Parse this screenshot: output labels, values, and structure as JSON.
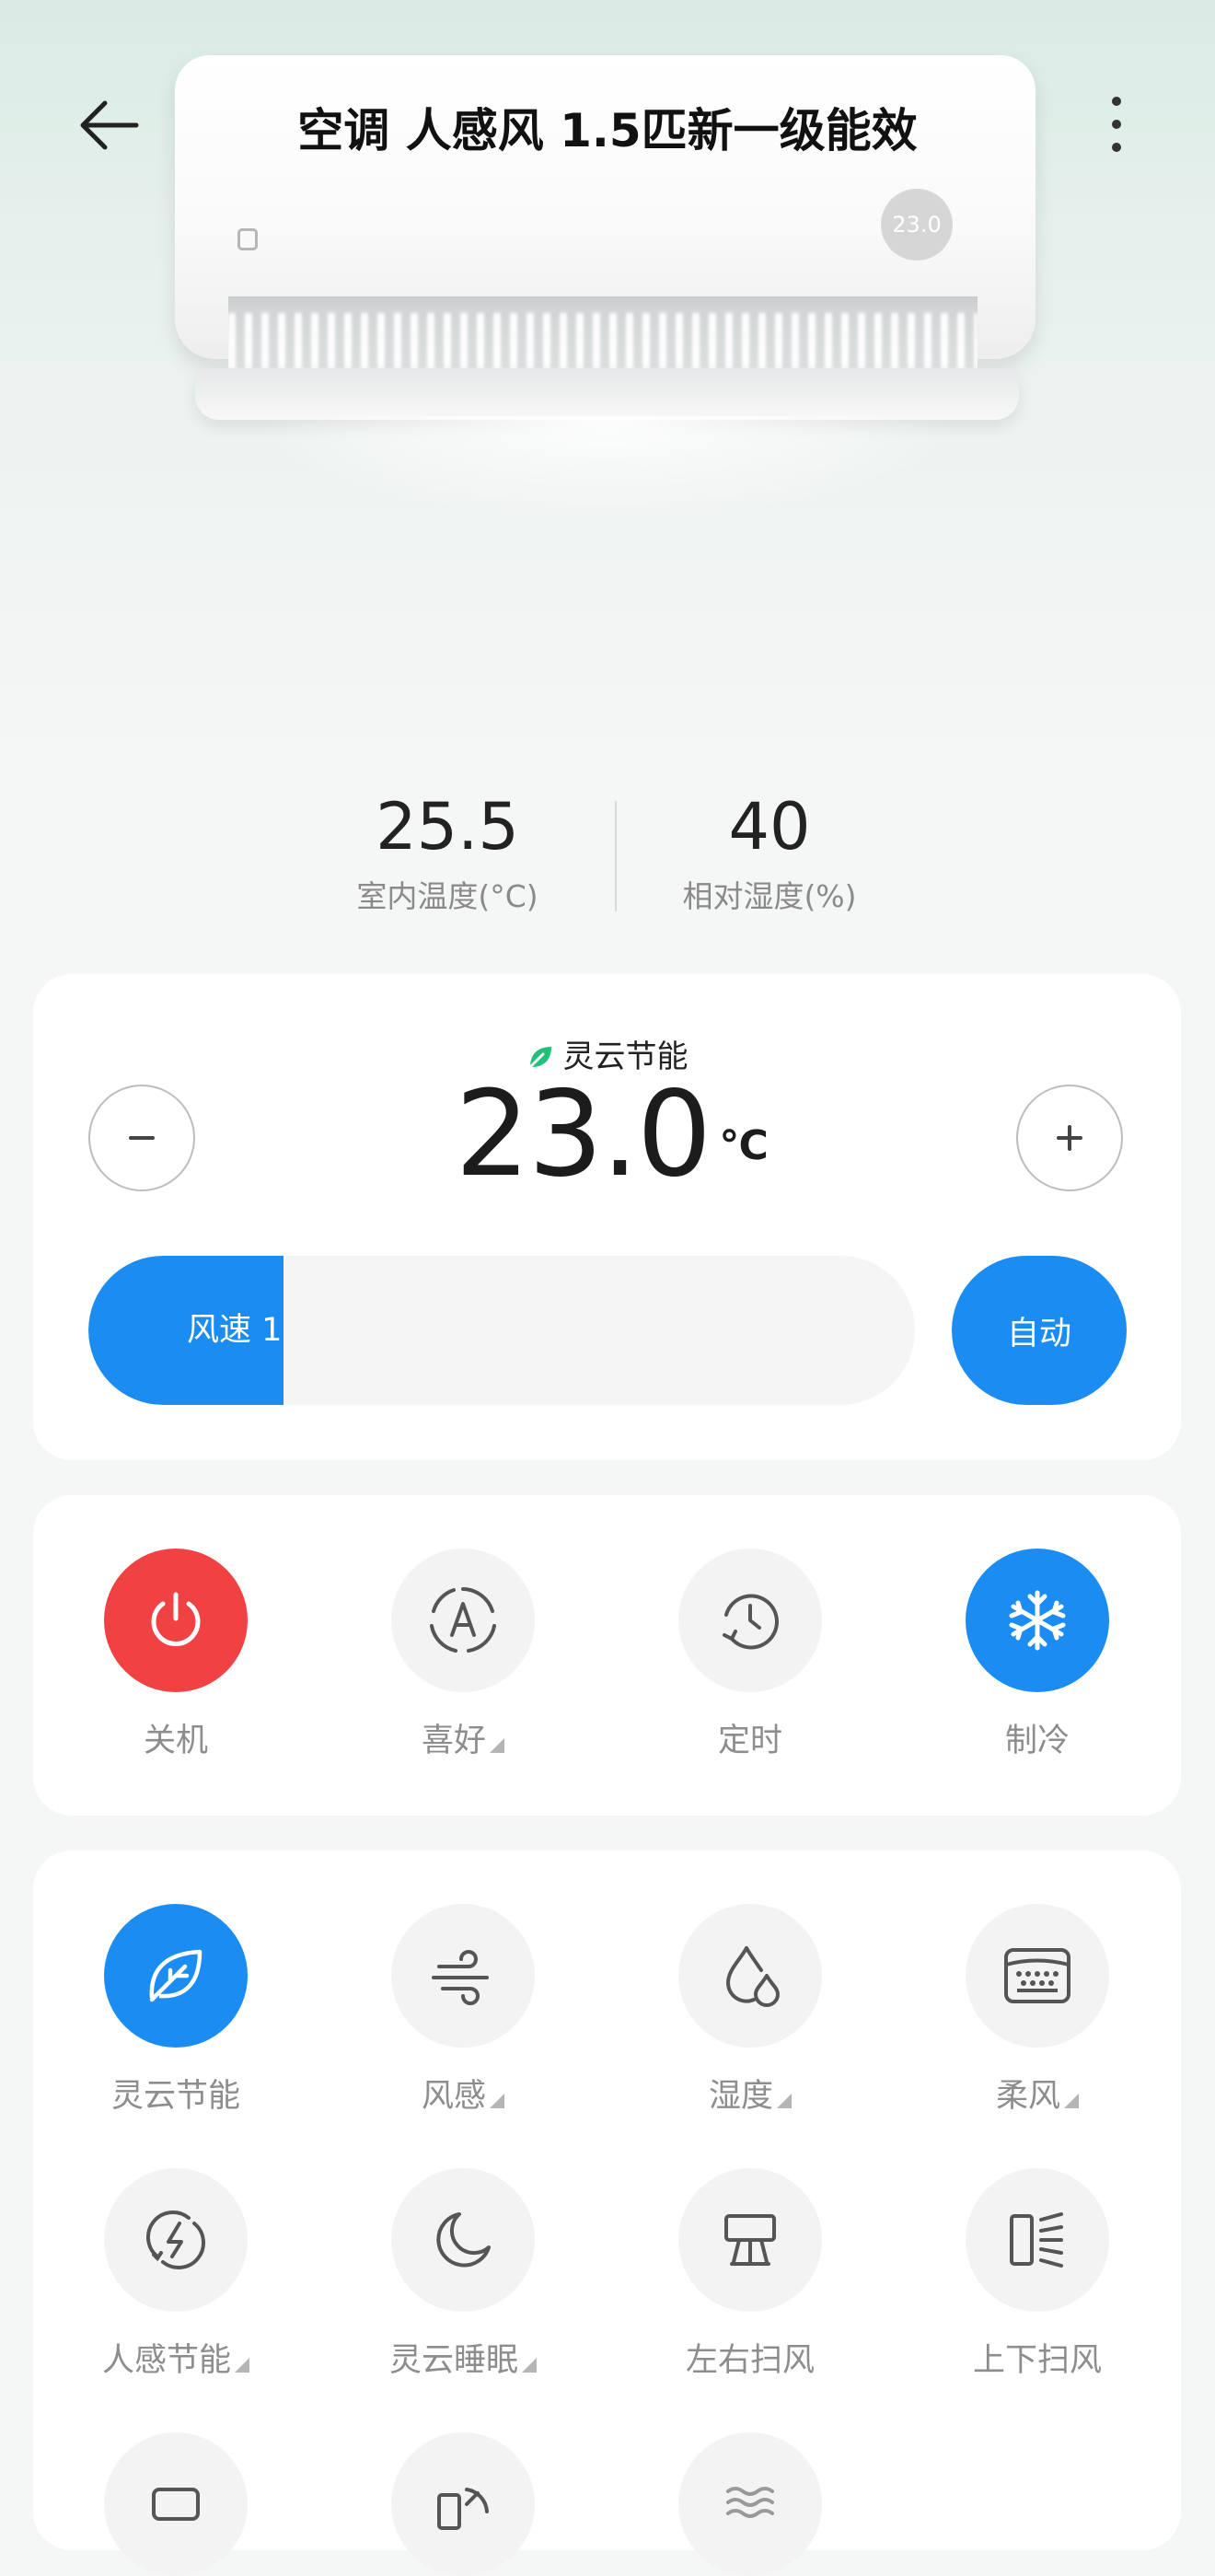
{
  "header": {
    "title": "空调 人感风 1.5匹新一级能效",
    "back_icon": "arrow-left-icon",
    "more_icon": "more-vertical-icon"
  },
  "device_image": {
    "display_temp": "23.0"
  },
  "readings": {
    "indoor_temp": {
      "value": "25.5",
      "label": "室内温度(°C)"
    },
    "humidity": {
      "value": "40",
      "label": "相对湿度(%)"
    }
  },
  "temp_card": {
    "eco_label": "灵云节能",
    "target_temp": "23.0",
    "unit": "℃",
    "fan_speed_label": "风速 1",
    "fan_speed_level": 0.2,
    "auto_label": "自动"
  },
  "controls": [
    {
      "label": "关机",
      "icon": "power-icon",
      "has_menu": false,
      "active": true,
      "color": "#f04143"
    },
    {
      "label": "喜好",
      "icon": "auto-mode-icon",
      "has_menu": true,
      "active": false
    },
    {
      "label": "定时",
      "icon": "timer-icon",
      "has_menu": false,
      "active": false
    },
    {
      "label": "制冷",
      "icon": "snowflake-icon",
      "has_menu": false,
      "active": true,
      "color": "#1a8cf2"
    }
  ],
  "functions": [
    {
      "label": "灵云节能",
      "icon": "leaf-icon",
      "has_menu": false,
      "active": true
    },
    {
      "label": "风感",
      "icon": "wind-icon",
      "has_menu": true,
      "active": false
    },
    {
      "label": "湿度",
      "icon": "humidity-icon",
      "has_menu": true,
      "active": false
    },
    {
      "label": "柔风",
      "icon": "soft-wind-icon",
      "has_menu": true,
      "active": false
    },
    {
      "label": "人感节能",
      "icon": "presence-energy-icon",
      "has_menu": true,
      "active": false
    },
    {
      "label": "灵云睡眠",
      "icon": "moon-icon",
      "has_menu": true,
      "active": false
    },
    {
      "label": "左右扫风",
      "icon": "horizontal-swing-icon",
      "has_menu": false,
      "active": false
    },
    {
      "label": "上下扫风",
      "icon": "vertical-swing-icon",
      "has_menu": false,
      "active": false
    }
  ],
  "colors": {
    "accent": "#1a8cf2",
    "power": "#f04143",
    "eco_green": "#22c07a"
  }
}
